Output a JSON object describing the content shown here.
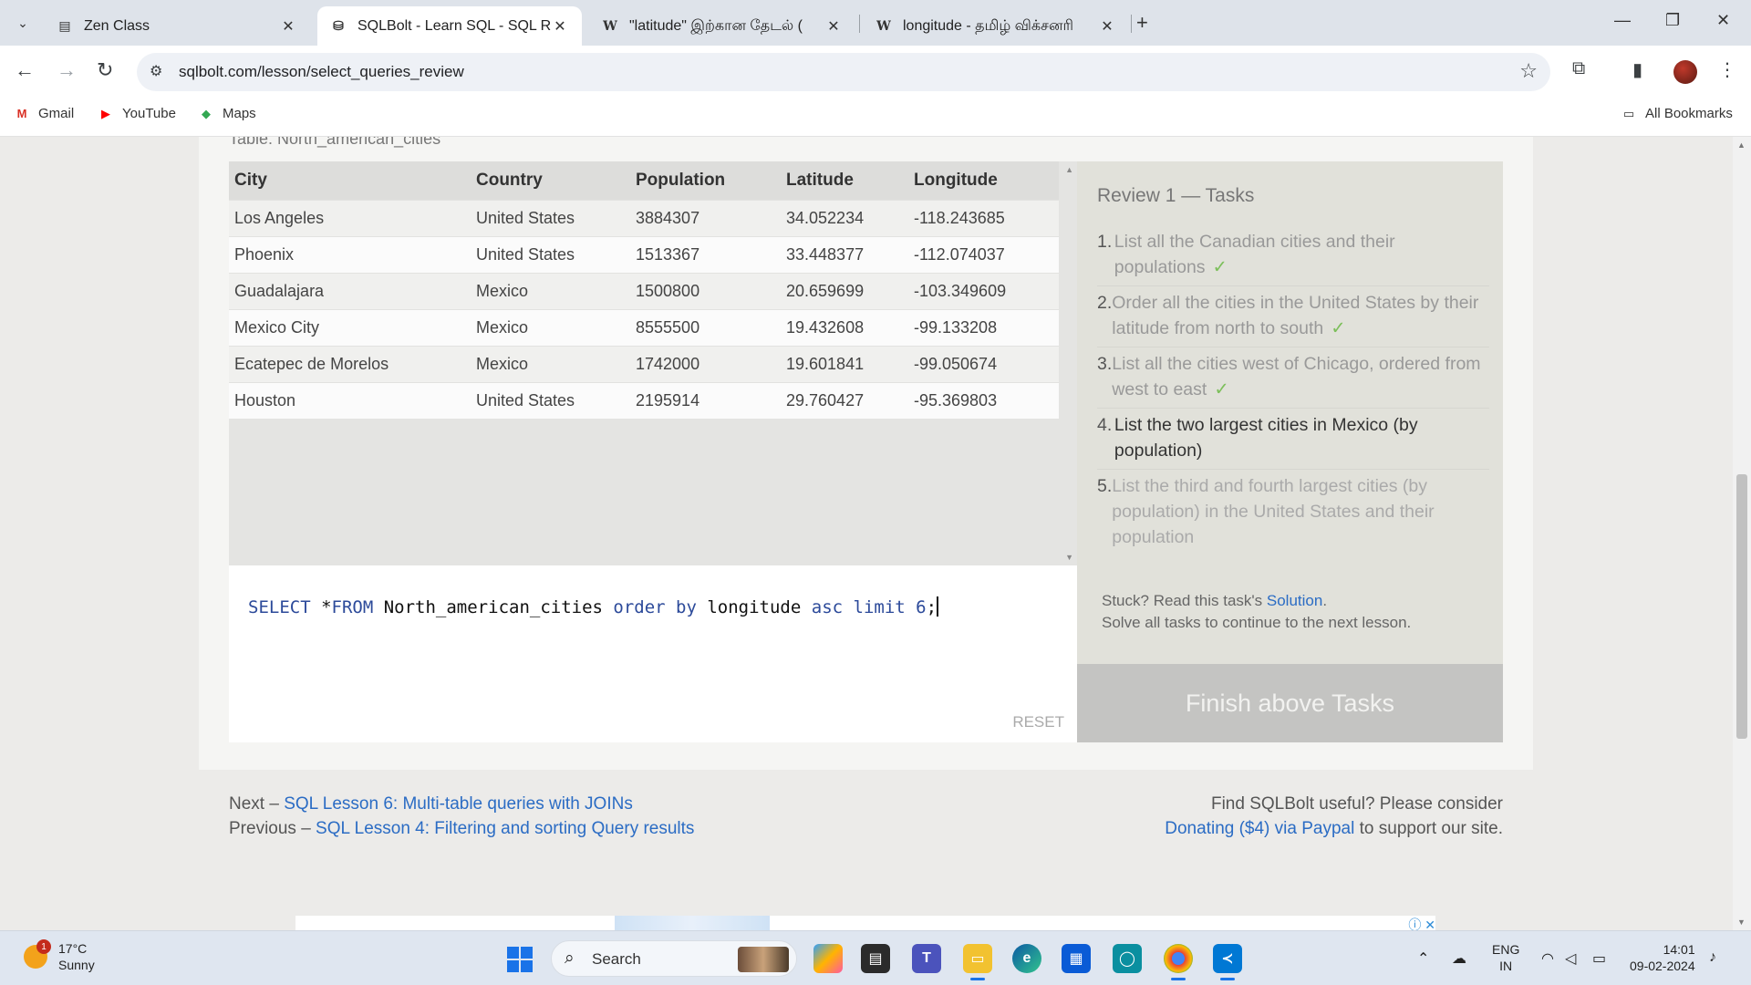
{
  "browser": {
    "tabs": [
      {
        "title": "Zen Class",
        "icon": "zen-class-favicon"
      },
      {
        "title": "SQLBolt - Learn SQL - SQL Revi",
        "icon": "sqlbolt-favicon"
      },
      {
        "title": "\"latitude\" இற்கான தேடல் (",
        "icon": "wikipedia-favicon"
      },
      {
        "title": "longitude - தமிழ் விக்சனரி",
        "icon": "wiktionary-favicon"
      }
    ],
    "url": "sqlbolt.com/lesson/select_queries_review",
    "bookmarks": [
      {
        "label": "Gmail",
        "icon": "gmail-icon"
      },
      {
        "label": "YouTube",
        "icon": "youtube-icon"
      },
      {
        "label": "Maps",
        "icon": "maps-icon"
      }
    ],
    "all_bookmarks": "All Bookmarks"
  },
  "lesson": {
    "table_label": "Table: North_american_cities",
    "columns": [
      "City",
      "Country",
      "Population",
      "Latitude",
      "Longitude"
    ],
    "rows": [
      [
        "Los Angeles",
        "United States",
        "3884307",
        "34.052234",
        "-118.243685"
      ],
      [
        "Phoenix",
        "United States",
        "1513367",
        "33.448377",
        "-112.074037"
      ],
      [
        "Guadalajara",
        "Mexico",
        "1500800",
        "20.659699",
        "-103.349609"
      ],
      [
        "Mexico City",
        "Mexico",
        "8555500",
        "19.432608",
        "-99.133208"
      ],
      [
        "Ecatepec de Morelos",
        "Mexico",
        "1742000",
        "19.601841",
        "-99.050674"
      ],
      [
        "Houston",
        "United States",
        "2195914",
        "29.760427",
        "-95.369803"
      ]
    ],
    "query": {
      "parts": [
        {
          "text": "SELECT",
          "kind": "kw"
        },
        {
          "text": " *",
          "kind": "plain"
        },
        {
          "text": "FROM",
          "kind": "kw"
        },
        {
          "text": " North_american_cities ",
          "kind": "plain"
        },
        {
          "text": "order by",
          "kind": "kw"
        },
        {
          "text": " longitude ",
          "kind": "plain"
        },
        {
          "text": "asc limit",
          "kind": "kw"
        },
        {
          "text": " ",
          "kind": "plain"
        },
        {
          "text": "6",
          "kind": "num"
        },
        {
          "text": ";",
          "kind": "plain"
        }
      ]
    },
    "reset_label": "RESET",
    "tasks_heading": "Review 1 — Tasks",
    "tasks": [
      {
        "num": "1.",
        "text": "List all the Canadian cities and their populations",
        "done": true,
        "state": "done"
      },
      {
        "num": "2.",
        "text": "Order all the cities in the United States by their latitude from north to south",
        "done": true,
        "state": "done"
      },
      {
        "num": "3.",
        "text": "List all the cities west of Chicago, ordered from west to east",
        "done": true,
        "state": "done"
      },
      {
        "num": "4.",
        "text": "List the two largest cities in Mexico (by population)",
        "done": false,
        "state": "current"
      },
      {
        "num": "5.",
        "text": "List the third and fourth largest cities (by population) in the United States and their population",
        "done": false,
        "state": "future"
      }
    ],
    "check_mark": "✓",
    "stuck_prefix": "Stuck? Read this task's ",
    "solution_link": "Solution",
    "stuck_suffix": ".",
    "solve_all": "Solve all tasks to continue to the next lesson.",
    "finish_button": "Finish above Tasks"
  },
  "footer": {
    "next_prefix": "Next – ",
    "next_link": "SQL Lesson 6: Multi-table queries with JOINs",
    "prev_prefix": "Previous – ",
    "prev_link": "SQL Lesson 4: Filtering and sorting Query results",
    "useful": "Find SQLBolt useful? Please consider",
    "donate_link": "Donating ($4) via Paypal",
    "donate_suffix": " to support our site."
  },
  "taskbar": {
    "weather_temp": "17°C",
    "weather_cond": "Sunny",
    "weather_badge": "1",
    "search_label": "Search",
    "lang_top": "ENG",
    "lang_bottom": "IN",
    "time": "14:01",
    "date": "09-02-2024"
  },
  "colors": {
    "link": "#2b6cc4",
    "check": "#7cbf5a",
    "finish_bg": "#c4c4c2",
    "sql_keyword": "#2c4a9a"
  }
}
